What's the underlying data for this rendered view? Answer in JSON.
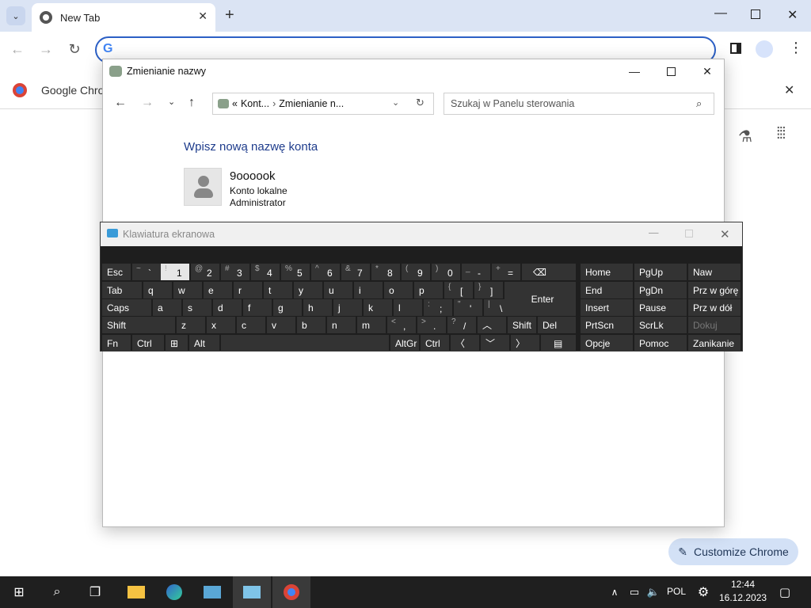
{
  "browser": {
    "tab_title": "New Tab",
    "bookmark_label": "Google Chrom",
    "customize_label": "Customize Chrome"
  },
  "explorer": {
    "title": "Zmienianie nazwy",
    "breadcrumb_prefix": "«",
    "breadcrumb_1": "Kont...",
    "breadcrumb_2": "Zmienianie n...",
    "search_placeholder": "Szukaj w Panelu sterowania",
    "heading": "Wpisz nową nazwę konta",
    "account_name": "9oooook",
    "account_type": "Konto lokalne",
    "account_role": "Administrator"
  },
  "osk": {
    "title": "Klawiatura ekranowa",
    "keys": {
      "esc": "Esc",
      "tab": "Tab",
      "caps": "Caps",
      "shift": "Shift",
      "fn": "Fn",
      "ctrl": "Ctrl",
      "alt": "Alt",
      "altgr": "AltGr",
      "ctrl2": "Ctrl",
      "enter": "Enter",
      "shift2": "Shift",
      "del": "Del",
      "home": "Home",
      "pgup": "PgUp",
      "naw": "Naw",
      "end": "End",
      "pgdn": "PgDn",
      "przwgore": "Prz w górę",
      "insert": "Insert",
      "pause": "Pause",
      "przwdol": "Prz w dół",
      "prtscn": "PrtScn",
      "scrlk": "ScrLk",
      "dokuj": "Dokuj",
      "opcje": "Opcje",
      "pomoc": "Pomoc",
      "zanikanie": "Zanikanie"
    },
    "row1": [
      {
        "s": "~",
        "m": "`"
      },
      {
        "s": "!",
        "m": "1"
      },
      {
        "s": "@",
        "m": "2"
      },
      {
        "s": "#",
        "m": "3"
      },
      {
        "s": "$",
        "m": "4"
      },
      {
        "s": "%",
        "m": "5"
      },
      {
        "s": "^",
        "m": "6"
      },
      {
        "s": "&",
        "m": "7"
      },
      {
        "s": "*",
        "m": "8"
      },
      {
        "s": "(",
        "m": "9"
      },
      {
        "s": ")",
        "m": "0"
      },
      {
        "s": "_",
        "m": "-"
      },
      {
        "s": "+",
        "m": "="
      }
    ],
    "row2": [
      "q",
      "w",
      "e",
      "r",
      "t",
      "y",
      "u",
      "i",
      "o",
      "p"
    ],
    "row2_br": [
      {
        "s": "{",
        "m": "["
      },
      {
        "s": "}",
        "m": "]"
      }
    ],
    "row3": [
      "a",
      "s",
      "d",
      "f",
      "g",
      "h",
      "j",
      "k",
      "l"
    ],
    "row3_p": [
      {
        "s": ":",
        "m": ";"
      },
      {
        "s": "\"",
        "m": "'"
      },
      {
        "s": "|",
        "m": "\\"
      }
    ],
    "row4": [
      "z",
      "x",
      "c",
      "v",
      "b",
      "n",
      "m"
    ],
    "row4_p": [
      {
        "s": "<",
        "m": ","
      },
      {
        "s": ">",
        "m": "."
      },
      {
        "s": "?",
        "m": "/"
      }
    ]
  },
  "taskbar": {
    "lang": "POL",
    "time": "12:44",
    "date": "16.12.2023"
  }
}
